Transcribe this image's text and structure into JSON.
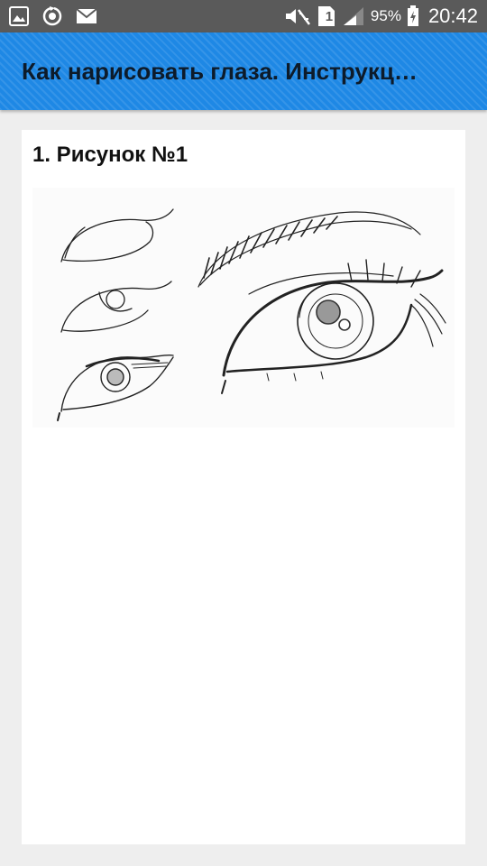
{
  "status_bar": {
    "battery_percent": "95%",
    "time": "20:42",
    "sim_slot": "1",
    "icons": [
      "gallery-icon",
      "sync-icon",
      "mail-icon",
      "mute-icon",
      "sim-icon",
      "signal-icon",
      "battery-charging-icon"
    ]
  },
  "app_bar": {
    "title": "Как нарисовать глаза. Инструкц…"
  },
  "content": {
    "heading": "1. Рисунок №1",
    "image": "eye-sketch-illustration"
  },
  "colors": {
    "app_bar": "#1e88e5",
    "status_bar": "#5a5a5a",
    "background": "#eeeeee",
    "card": "#ffffff"
  }
}
